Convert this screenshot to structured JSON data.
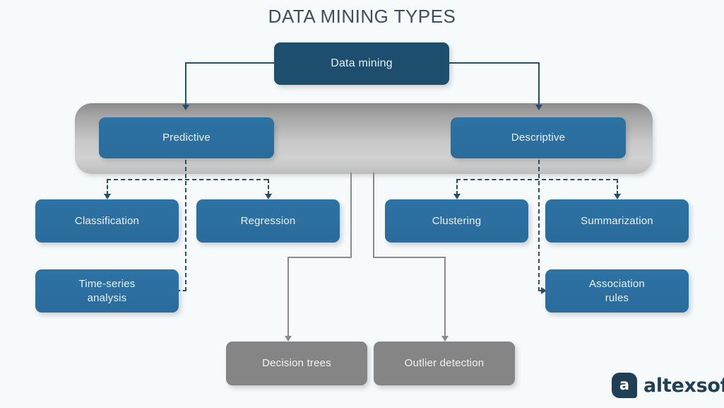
{
  "title": "DATA MINING TYPES",
  "colors": {
    "background": "#f7fafb",
    "root_box": "#1d4e6e",
    "blue_box": "#2d72a4",
    "gray_box": "#858585",
    "band_gradient_top": "#8a8a8a",
    "band_gradient_bottom": "#bdbdbd",
    "connector_dark": "#2b4e63",
    "connector_gray": "#8b8b8b",
    "title_text": "#3c4f5e",
    "logo": "#1f3f56"
  },
  "nodes": {
    "root": {
      "label": "Data mining"
    },
    "branches": [
      {
        "label": "Predictive"
      },
      {
        "label": "Descriptive"
      }
    ],
    "predictive_children": [
      {
        "label": "Classification"
      },
      {
        "label": "Regression"
      },
      {
        "label": "Time-series\nanalysis"
      }
    ],
    "descriptive_children": [
      {
        "label": "Clustering"
      },
      {
        "label": "Summarization"
      },
      {
        "label": "Association\nrules"
      }
    ],
    "shared_children": [
      {
        "label": "Decision trees"
      },
      {
        "label": "Outlier detection"
      }
    ]
  },
  "node_labels": {
    "root": "Data mining",
    "predictive": "Predictive",
    "descriptive": "Descriptive",
    "classification": "Classification",
    "regression": "Regression",
    "clustering": "Clustering",
    "summarization": "Summarization",
    "time_series_line1": "Time-series",
    "time_series_line2": "analysis",
    "association_line1": "Association",
    "association_line2": "rules",
    "decision_trees": "Decision trees",
    "outlier_detection": "Outlier detection"
  },
  "logo": {
    "mark": "a",
    "text": "altexsoft"
  }
}
